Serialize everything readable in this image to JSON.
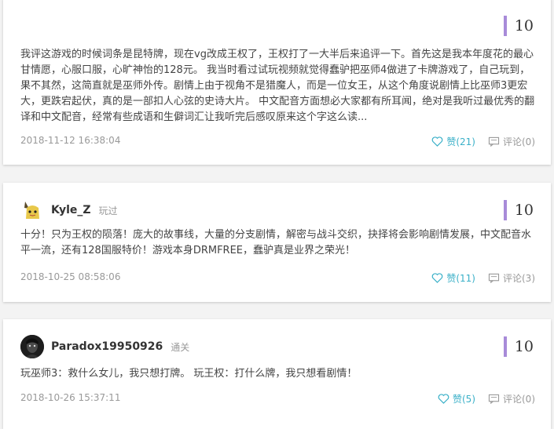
{
  "reviews": [
    {
      "user": null,
      "score": "10",
      "content": "我评这游戏的时候词条是昆特牌，现在vg改成王权了，王权打了一大半后来追评一下。首先这是我本年度花的最心甘情愿，心服口服，心旷神怡的128元。 我当时看过试玩视频就觉得蠢驴把巫师4做进了卡牌游戏了，自己玩到，果不其然，这简直就是巫师外传。剧情上由于视角不是猎魔人，而是一位女王，从这个角度说剧情上比巫师3更宏大，更跌宕起伏，真的是一部扣人心弦的史诗大片。 中文配音方面想必大家都有所耳闻，绝对是我听过最优秀的翻译和中文配音，经常有些成语和生僻词汇让我听完后感叹原来这个字这么读...",
      "date": "2018-11-12 16:38:04",
      "likes": "赞(21)",
      "comments": "评论(0)"
    },
    {
      "user": {
        "name": "Kyle_Z",
        "status": "玩过",
        "avatar_icon": "yellow-creature-avatar"
      },
      "score": "10",
      "content": "十分！只为王权的陨落！庞大的故事线，大量的分支剧情，解密与战斗交织，抉择将会影响剧情发展，中文配音水平一流，还有128国服特价！游戏本身DRMFREE，蠢驴真是业界之荣光！",
      "date": "2018-10-25 08:58:06",
      "likes": "赞(11)",
      "comments": "评论(3)"
    },
    {
      "user": {
        "name": "Paradox19950926",
        "status": "通关",
        "avatar_icon": "dark-face-avatar"
      },
      "score": "10",
      "content": "玩巫师3：救什么女儿，我只想打牌。 玩王权：打什么牌，我只想看剧情！",
      "date": "2018-10-26 15:37:11",
      "likes": "赞(5)",
      "comments": "评论(0)"
    }
  ],
  "colors": {
    "score_bar": "#a88bd9",
    "like": "#3ab0c8",
    "muted": "#999999"
  }
}
